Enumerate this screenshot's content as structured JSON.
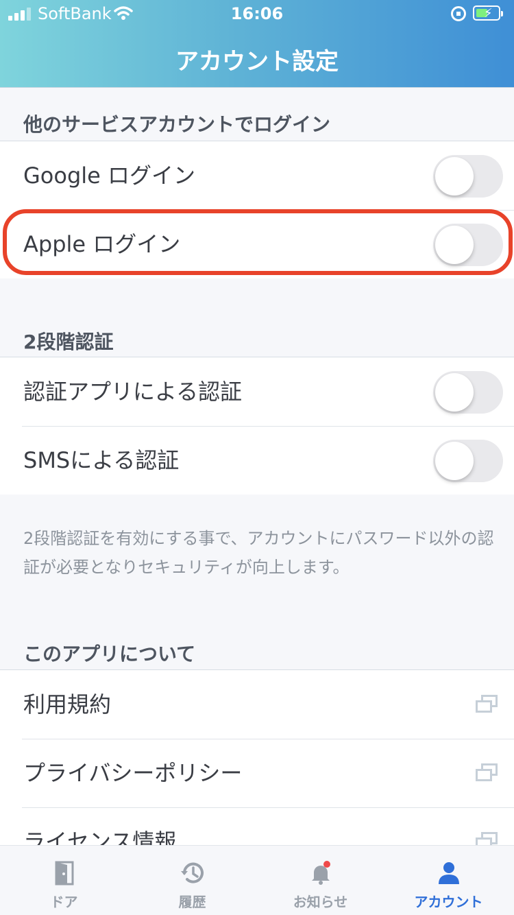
{
  "status_bar": {
    "carrier": "SoftBank",
    "time": "16:06"
  },
  "header": {
    "title": "アカウント設定"
  },
  "sections": {
    "service_login": {
      "header": "他のサービスアカウントでログイン",
      "items": [
        {
          "label": "Google ログイン",
          "toggle": false
        },
        {
          "label": "Apple ログイン",
          "toggle": false
        }
      ]
    },
    "two_factor": {
      "header": "2段階認証",
      "items": [
        {
          "label": "認証アプリによる認証",
          "toggle": false
        },
        {
          "label": "SMSによる認証",
          "toggle": false
        }
      ],
      "note": "2段階認証を有効にする事で、アカウントにパスワード以外の認証が必要となりセキュリティが向上します。"
    },
    "about": {
      "header": "このアプリについて",
      "items": [
        {
          "label": "利用規約",
          "icon": "external-link-icon"
        },
        {
          "label": "プライバシーポリシー",
          "icon": "external-link-icon"
        },
        {
          "label": "ライセンス情報",
          "icon": "external-link-icon"
        }
      ]
    }
  },
  "tabbar": {
    "items": [
      {
        "label": "ドア",
        "icon": "door-icon",
        "active": false
      },
      {
        "label": "履歴",
        "icon": "history-icon",
        "active": false
      },
      {
        "label": "お知らせ",
        "icon": "bell-icon",
        "active": false,
        "badge": true
      },
      {
        "label": "アカウント",
        "icon": "person-icon",
        "active": true
      }
    ]
  },
  "colors": {
    "accent": "#2f6fd8",
    "highlight": "#e8432a",
    "badge": "#ef4a4a"
  }
}
